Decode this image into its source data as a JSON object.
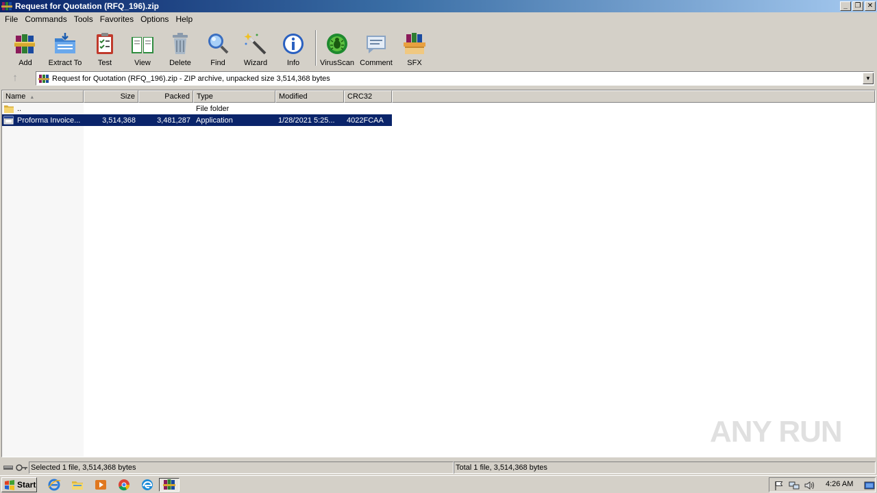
{
  "window": {
    "title": "Request for Quotation (RFQ_196).zip",
    "controls": {
      "minimize": "_",
      "restore": "❐",
      "close": "✕"
    }
  },
  "menu": [
    "File",
    "Commands",
    "Tools",
    "Favorites",
    "Options",
    "Help"
  ],
  "toolbar": [
    {
      "label": "Add",
      "icon": "winrar-books-icon"
    },
    {
      "label": "Extract To",
      "icon": "extract-folder-icon"
    },
    {
      "label": "Test",
      "icon": "test-clipboard-icon"
    },
    {
      "label": "View",
      "icon": "view-book-icon"
    },
    {
      "label": "Delete",
      "icon": "trash-can-icon"
    },
    {
      "label": "Find",
      "icon": "magnifier-icon"
    },
    {
      "label": "Wizard",
      "icon": "magic-wand-icon"
    },
    {
      "label": "Info",
      "icon": "info-icon"
    },
    {
      "label": "VirusScan",
      "icon": "virus-scan-icon"
    },
    {
      "label": "Comment",
      "icon": "comment-icon"
    },
    {
      "label": "SFX",
      "icon": "sfx-box-icon"
    }
  ],
  "address": {
    "text": "Request for Quotation (RFQ_196).zip - ZIP archive, unpacked size 3,514,368 bytes",
    "up_icon": "up-arrow-icon"
  },
  "columns": [
    "Name",
    "Size",
    "Packed",
    "Type",
    "Modified",
    "CRC32"
  ],
  "rows": [
    {
      "name": "..",
      "size": "",
      "packed": "",
      "type": "File folder",
      "modified": "",
      "crc": "",
      "icon": "folder-icon",
      "selected": false
    },
    {
      "name": "Proforma Invoice...",
      "size": "3,514,368",
      "packed": "3,481,287",
      "type": "Application",
      "modified": "1/28/2021 5:25...",
      "crc": "4022FCAA",
      "icon": "application-icon",
      "selected": true
    }
  ],
  "status": {
    "left": "Selected 1 file, 3,514,368 bytes",
    "right": "Total 1 file, 3,514,368 bytes"
  },
  "taskbar": {
    "start": "Start",
    "clock": "4:26 AM",
    "pinned": [
      "internet-explorer-icon",
      "file-explorer-icon",
      "media-player-icon",
      "chrome-icon",
      "edge-icon",
      "winrar-icon"
    ],
    "tray": [
      "flag-icon",
      "network-icon",
      "volume-icon",
      "show-desktop-icon"
    ]
  },
  "watermark": "ANY RUN",
  "colors": {
    "title_start": "#0a246a",
    "title_end": "#a6caf0",
    "selection": "#0a246a",
    "chrome": "#d4d0c8"
  }
}
